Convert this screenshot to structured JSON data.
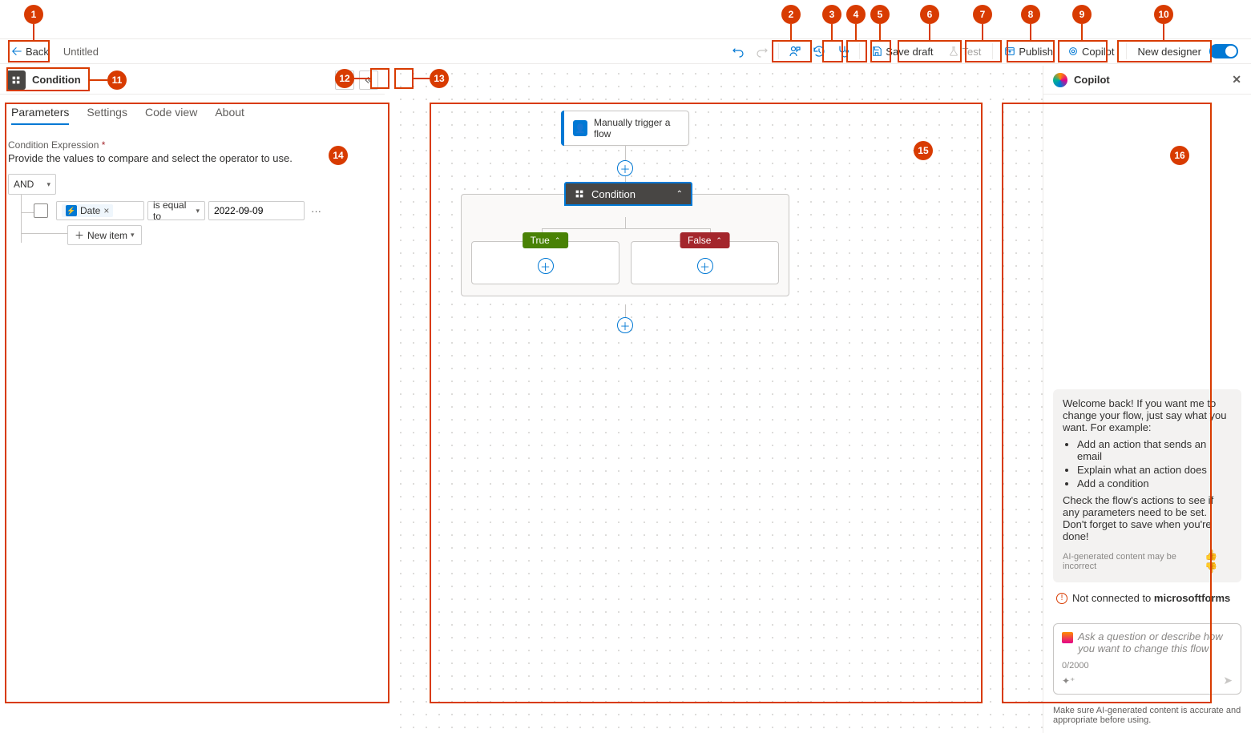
{
  "header": {
    "back": "Back",
    "title": "Untitled",
    "save_draft": "Save draft",
    "test": "Test",
    "publish": "Publish",
    "copilot_btn": "Copilot",
    "new_designer": "New designer"
  },
  "panel": {
    "title": "Condition",
    "tabs": {
      "parameters": "Parameters",
      "settings": "Settings",
      "code_view": "Code view",
      "about": "About"
    },
    "field_label": "Condition Expression",
    "field_desc": "Provide the values to compare and select the operator to use.",
    "and": "AND",
    "date_pill": "Date",
    "date_x": "×",
    "operator": "is equal to",
    "value": "2022-09-09",
    "row_more": "···",
    "new_item": "New item"
  },
  "canvas": {
    "trigger": "Manually trigger a flow",
    "condition": "Condition",
    "true_label": "True",
    "false_label": "False"
  },
  "copilot": {
    "title": "Copilot",
    "welcome": "Welcome back! If you want me to change your flow, just say what you want. For example:",
    "bullets": [
      "Add an action that sends an email",
      "Explain what an action does",
      "Add a condition"
    ],
    "followup": "Check the flow's actions to see if any parameters need to be set. Don't forget to save when you're done!",
    "ai_disclaimer": "AI-generated content may be incorrect",
    "not_connected_prefix": "Not connected to ",
    "not_connected_target": "microsoftforms",
    "placeholder": "Ask a question or describe how you want to change this flow",
    "counter": "0/2000",
    "footer": "Make sure AI-generated content is accurate and appropriate before using."
  },
  "bubbles": {
    "1": "1",
    "2": "2",
    "3": "3",
    "4": "4",
    "5": "5",
    "6": "6",
    "7": "7",
    "8": "8",
    "9": "9",
    "10": "10",
    "11": "11",
    "12": "12",
    "13": "13",
    "14": "14",
    "15": "15",
    "16": "16"
  }
}
